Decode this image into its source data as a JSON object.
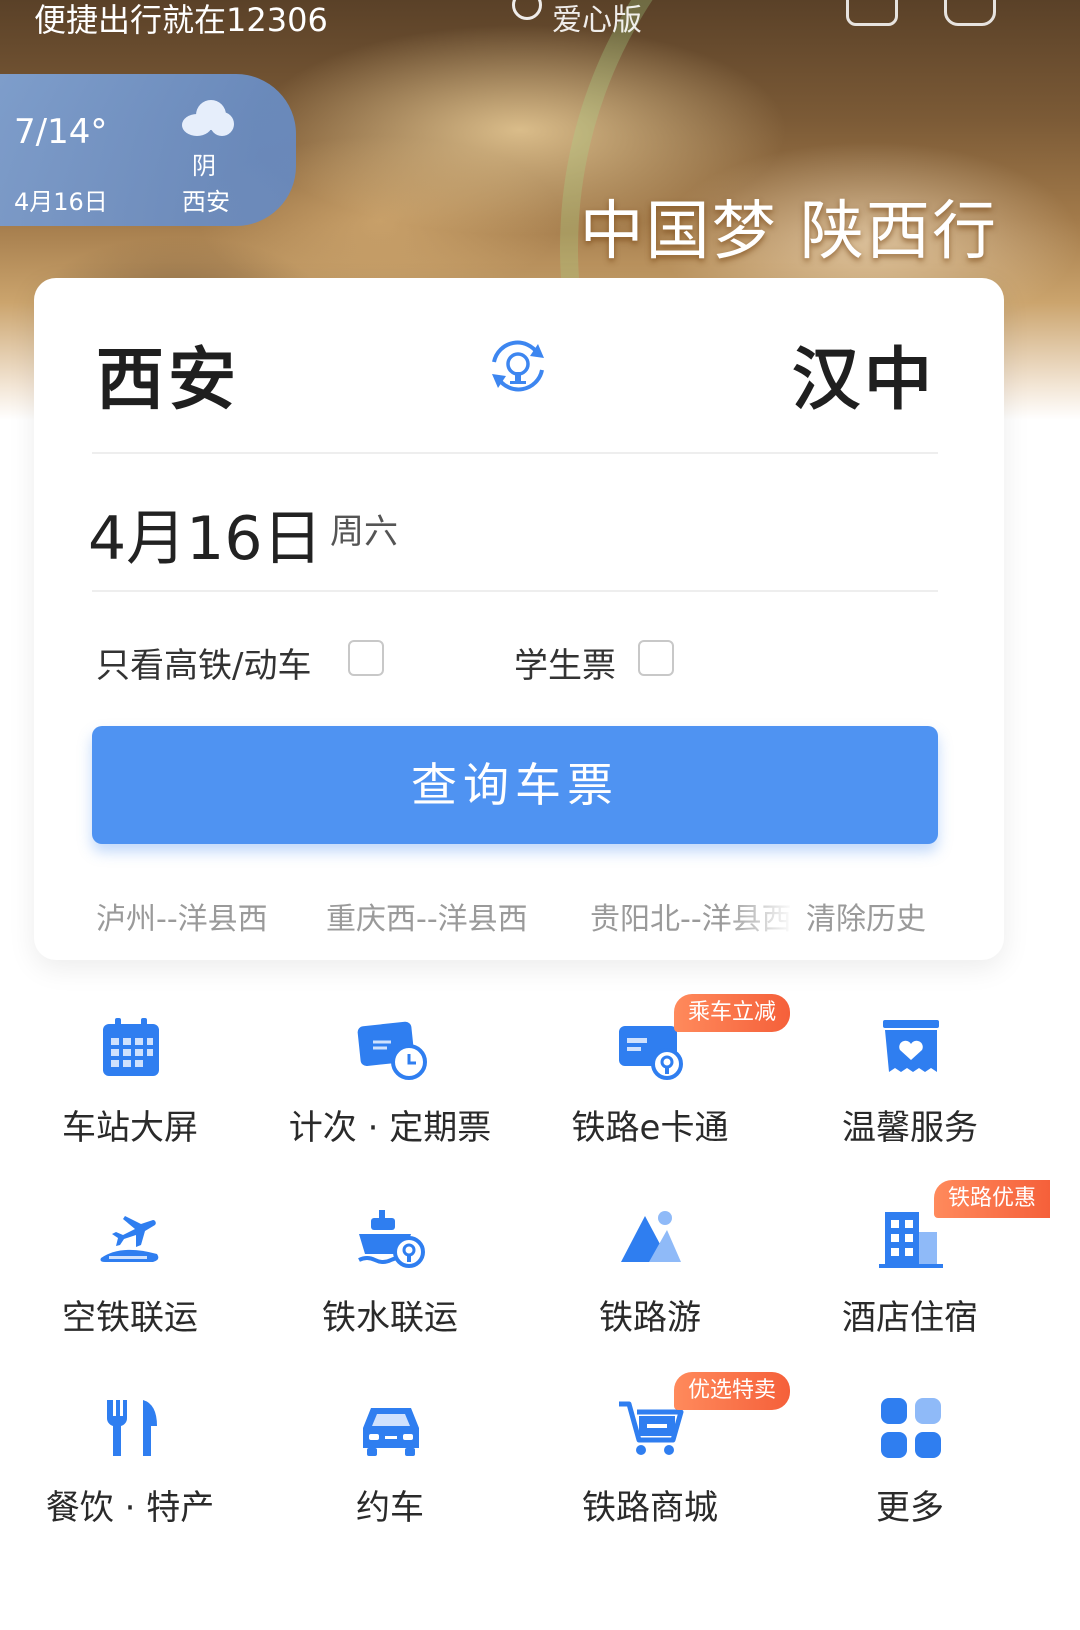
{
  "status_bar": {
    "text": "便捷出行就在12306",
    "care_mode": "爱心版"
  },
  "weather": {
    "temperature": "7/14°",
    "date": "4月16日",
    "condition": "阴",
    "city": "西安"
  },
  "banner": {
    "slogan": "中国梦 陕西行"
  },
  "search": {
    "from_station": "西安",
    "to_station": "汉中",
    "date": "4月16日",
    "weekday": "周六",
    "option_high_speed": "只看高铁/动车",
    "option_student": "学生票",
    "search_button": "查询车票",
    "history": [
      "泸州--洋县西",
      "重庆西--洋县西",
      "贵阳北--洋县西"
    ],
    "clear_history": "清除历史"
  },
  "services": [
    {
      "label": "车站大屏",
      "icon": "calendar-icon"
    },
    {
      "label": "计次 · 定期票",
      "icon": "ticket-clock-icon"
    },
    {
      "label": "铁路e卡通",
      "icon": "rail-card-icon",
      "badge": "乘车立减"
    },
    {
      "label": "温馨服务",
      "icon": "heart-box-icon"
    },
    {
      "label": "空铁联运",
      "icon": "plane-train-icon"
    },
    {
      "label": "铁水联运",
      "icon": "ship-icon"
    },
    {
      "label": "铁路游",
      "icon": "mountain-icon"
    },
    {
      "label": "酒店住宿",
      "icon": "hotel-icon",
      "badge": "铁路优惠"
    },
    {
      "label": "餐饮 · 特产",
      "icon": "fork-knife-icon"
    },
    {
      "label": "约车",
      "icon": "car-icon"
    },
    {
      "label": "铁路商城",
      "icon": "shopping-cart-icon",
      "badge": "优选特卖"
    },
    {
      "label": "更多",
      "icon": "grid-more-icon"
    }
  ],
  "colors": {
    "primary_blue": "#4f93f2",
    "icon_blue": "#2f7ef0",
    "badge_orange": "#f5603a"
  }
}
